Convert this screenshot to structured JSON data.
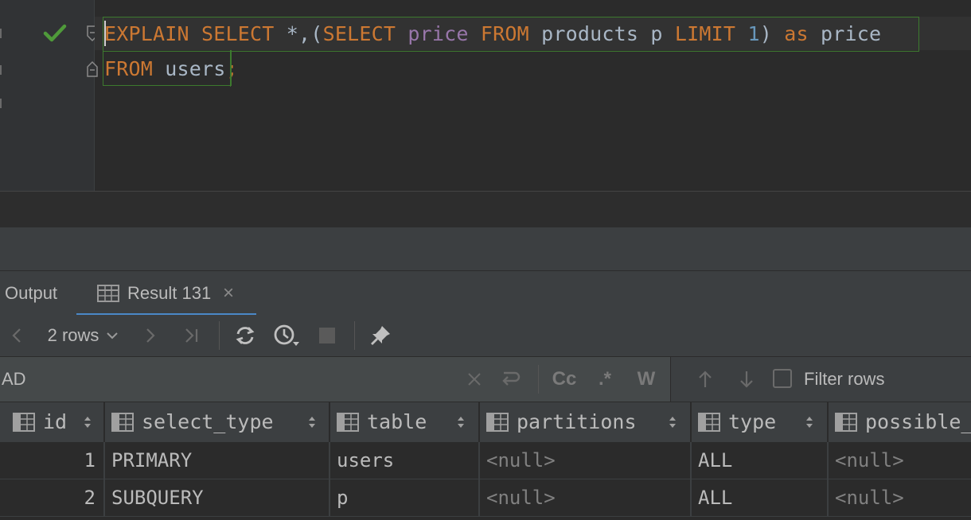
{
  "editor": {
    "line1_tokens": [
      {
        "t": "EXPLAIN",
        "c": "kw"
      },
      {
        "t": " ",
        "c": "op"
      },
      {
        "t": "SELECT",
        "c": "kw"
      },
      {
        "t": " *,(",
        "c": "op"
      },
      {
        "t": "SELECT",
        "c": "kw"
      },
      {
        "t": " ",
        "c": "op"
      },
      {
        "t": "price",
        "c": "fn"
      },
      {
        "t": " ",
        "c": "op"
      },
      {
        "t": "FROM",
        "c": "kw"
      },
      {
        "t": " products p ",
        "c": "id"
      },
      {
        "t": "LIMIT",
        "c": "kw"
      },
      {
        "t": " ",
        "c": "op"
      },
      {
        "t": "1",
        "c": "num"
      },
      {
        "t": ") ",
        "c": "op"
      },
      {
        "t": "as",
        "c": "kw"
      },
      {
        "t": " price",
        "c": "id"
      }
    ],
    "line2_tokens": [
      {
        "t": "FROM",
        "c": "kw"
      },
      {
        "t": " users",
        "c": "id"
      },
      {
        "t": ";",
        "c": "kw"
      }
    ],
    "status_icon": "check-icon"
  },
  "tabs": {
    "output_label": "Output",
    "result_label": "Result 131",
    "close_glyph": "×"
  },
  "toolbar": {
    "rows_label": "2 rows"
  },
  "filter": {
    "search_value": "AD",
    "cc_label": "Cc",
    "regex_label": ".*",
    "word_label": "W",
    "filter_rows_label": "Filter rows"
  },
  "grid": {
    "columns": [
      "id",
      "select_type",
      "table",
      "partitions",
      "type",
      "possible_"
    ],
    "rows": [
      {
        "id": "1",
        "select_type": "PRIMARY",
        "table": "users",
        "partitions": "<null>",
        "type": "ALL",
        "possible": "<null>"
      },
      {
        "id": "2",
        "select_type": "SUBQUERY",
        "table": "p",
        "partitions": "<null>",
        "type": "ALL",
        "possible": "<null>"
      }
    ]
  },
  "colors": {
    "keyword": "#cc7832",
    "function": "#9876aa",
    "identifier": "#a9b7c6",
    "number": "#6897bb",
    "check": "#4f9a3a",
    "tab_underline": "#4a88c7"
  }
}
